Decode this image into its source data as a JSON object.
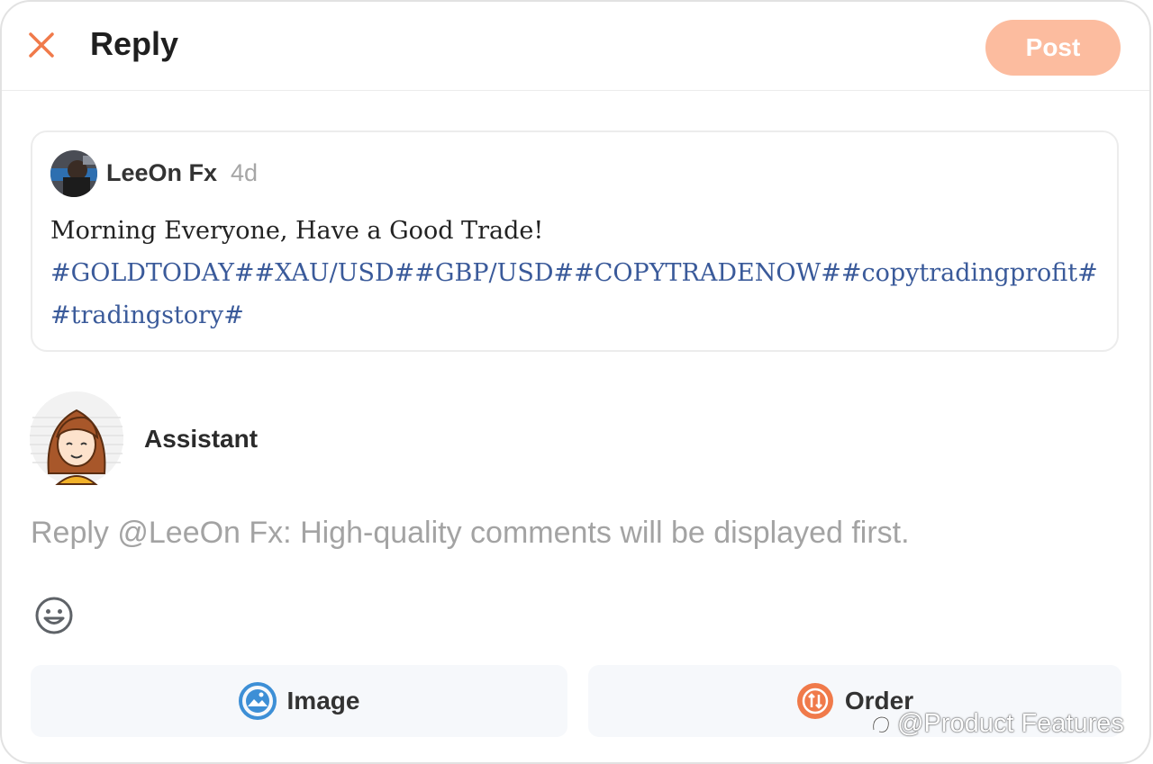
{
  "header": {
    "close_icon": "close-icon",
    "title": "Reply",
    "post_label": "Post"
  },
  "quoted_post": {
    "author": "LeeOn Fx",
    "time_ago": "4d",
    "text": "Morning Everyone, Have a Good Trade!",
    "tags": "#GOLDTODAY##XAU/USD##GBP/USD##COPYTRADENOW##copytradingprofit##tradingstory#"
  },
  "reply": {
    "author": "Assistant",
    "placeholder": "Reply @LeeOn Fx: High-quality comments will be displayed first.",
    "value": ""
  },
  "toolbar": {
    "emoji_icon": "smiley-icon",
    "image_label": "Image",
    "image_icon": "image-icon",
    "order_label": "Order",
    "order_icon": "order-icon"
  },
  "watermark": {
    "text": "@Product Features"
  },
  "colors": {
    "accent": "#f07a4a",
    "post_button_disabled": "#fcbc9f",
    "hashtag": "#3a5a9a",
    "image_icon": "#3d8fd6",
    "order_icon": "#f07a4a"
  }
}
